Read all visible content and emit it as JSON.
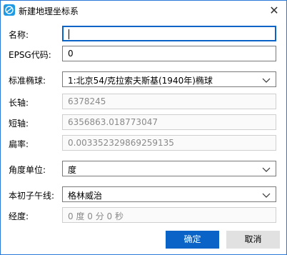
{
  "window": {
    "title": "新建地理坐标系",
    "close": "✕"
  },
  "fields": {
    "name": {
      "label": "名称:",
      "value": ""
    },
    "epsg": {
      "label": "EPSG代码:",
      "value": "0"
    },
    "ellipsoid": {
      "label": "标准椭球:",
      "value": "1:北京54/克拉索夫斯基(1940年)椭球"
    },
    "semi_major": {
      "label": "长轴:",
      "value": "6378245"
    },
    "semi_minor": {
      "label": "短轴:",
      "value": "6356863.018773047"
    },
    "flattening": {
      "label": "扁率:",
      "value": "0.003352329869259135"
    },
    "angle_unit": {
      "label": "角度单位:",
      "value": "度"
    },
    "prime_meridian": {
      "label": "本初子午线:",
      "value": "格林威治"
    },
    "longitude": {
      "label": "经度:",
      "value": "0 度 0 分 0 秒"
    }
  },
  "buttons": {
    "ok": "确定",
    "cancel": "取消"
  },
  "colors": {
    "accent": "#0a64c8",
    "border": "#7a7a7a",
    "disabled_text": "#8a8a8a"
  }
}
